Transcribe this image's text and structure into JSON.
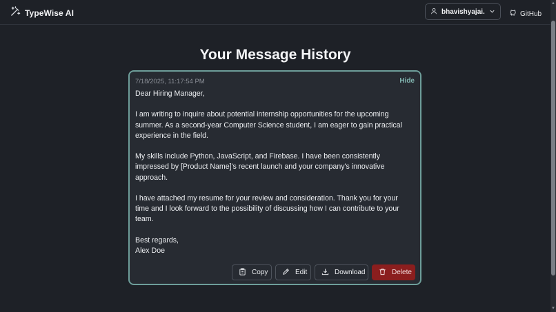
{
  "nav": {
    "brand": "TypeWise AI",
    "user": "bhavishyajai...",
    "github": "GitHub"
  },
  "page": {
    "title": "Your Message History"
  },
  "card": {
    "timestamp": "7/18/2025, 11:17:54 PM",
    "hide": "Hide",
    "paragraphs": [
      "Dear Hiring Manager,",
      "I am writing to inquire about potential internship opportunities for the upcoming summer. As a second-year Computer Science student, I am eager to gain practical experience in the field.",
      "My skills include Python, JavaScript, and Firebase. I have been consistently impressed by [Product Name]'s recent launch and your company's innovative approach.",
      "I have attached my resume for your review and consideration. Thank you for your time and I look forward to the possibility of discussing how I can contribute to your team."
    ],
    "closing": "Best regards,",
    "signature": "Alex Doe",
    "actions": {
      "copy": "Copy",
      "edit": "Edit",
      "download": "Download",
      "delete": "Delete"
    }
  },
  "colors": {
    "background": "#1e2127",
    "card_border": "#6e9e9a",
    "hide_link": "#7fb2ad",
    "delete_bg": "#8b1e1e"
  },
  "icons": {
    "brand": "magic-wand-icon",
    "user": "user-icon",
    "dropdown": "chevron-down-icon",
    "github": "github-icon",
    "copy": "clipboard-icon",
    "edit": "pencil-icon",
    "download": "download-icon",
    "delete": "trash-icon"
  }
}
